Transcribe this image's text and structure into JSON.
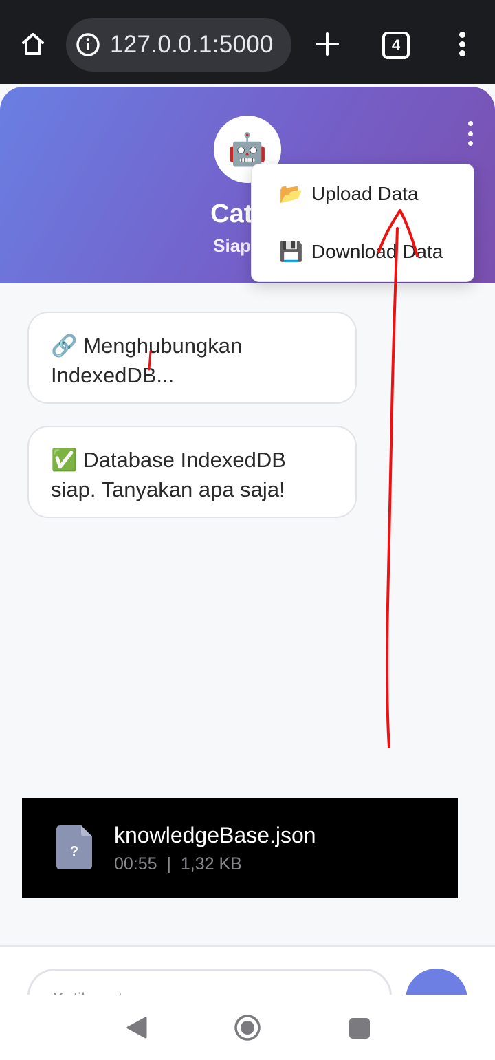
{
  "browser": {
    "url": "127.0.0.1:5000",
    "tab_count": "4"
  },
  "header": {
    "avatar_emoji": "🤖",
    "title": "Catbo",
    "subtitle": "Siap me"
  },
  "menu": {
    "upload": {
      "emoji": "📂",
      "label": "Upload Data"
    },
    "download": {
      "emoji": "💾",
      "label": "Download Data"
    }
  },
  "messages": [
    {
      "text": "🔗 Menghubungkan IndexedDB..."
    },
    {
      "text": "✅ Database IndexedDB siap. Tanyakan apa saja!"
    }
  ],
  "download_toast": {
    "file_name": "knowledgeBase.json",
    "time": "00:55",
    "size": "1,32 KB"
  },
  "input": {
    "placeholder": "Ketik pertanyaan..."
  },
  "colors": {
    "accent": "#6d7fe3",
    "header_gradient_start": "#6a7fe2",
    "header_gradient_end": "#7a4fae",
    "annotation": "#ee1111"
  },
  "icons": [
    "home-icon",
    "info-icon",
    "plus-icon",
    "tab-switcher-icon",
    "overflow-menu-icon",
    "folder-icon",
    "floppy-disk-icon",
    "link-icon",
    "check-mark-icon",
    "file-unknown-icon",
    "back-icon",
    "home-circle-icon",
    "recents-icon"
  ]
}
